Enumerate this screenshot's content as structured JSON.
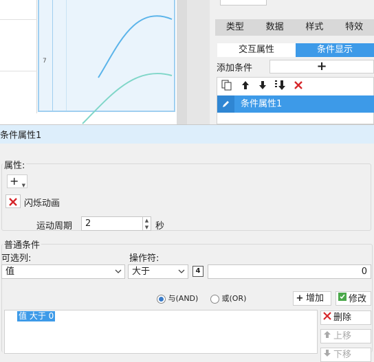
{
  "canvas": {
    "axis_label": "7"
  },
  "panel": {
    "tabs": [
      "类型",
      "数据",
      "样式",
      "特效"
    ],
    "subtabs": [
      "交互属性",
      "条件显示"
    ],
    "add_condition_label": "添加条件",
    "add_button_symbol": "+",
    "toolbar_icons": [
      "copy-icon",
      "arrow-up-icon",
      "arrow-down-icon",
      "move-bottom-icon",
      "delete-icon"
    ],
    "condition_item": "条件属性1"
  },
  "dialog": {
    "title": "条件属性1",
    "attributes": {
      "legend": "属性:",
      "add_symbol": "+",
      "effect_name": "闪烁动画",
      "period_label": "运动周期",
      "period_value": "2",
      "period_unit": "秒"
    },
    "common": {
      "legend": "普通条件",
      "column_label": "可选列:",
      "column_value": "值",
      "operator_label": "操作符:",
      "operator_value": "大于",
      "param_badge": "4",
      "compare_value": "0",
      "radio_and": "与(AND)",
      "radio_or": "或(OR)",
      "add_button": "增加",
      "modify_button": "修改",
      "delete_button": "删除",
      "move_up_button": "上移",
      "move_down_button": "下移",
      "conditions": [
        "值 大于 0"
      ]
    }
  },
  "colors": {
    "accent": "#3d9ae8",
    "delete_red": "#d6262a",
    "chart_line_1": "#5bb4ea",
    "chart_line_2": "#7fd6c8"
  }
}
